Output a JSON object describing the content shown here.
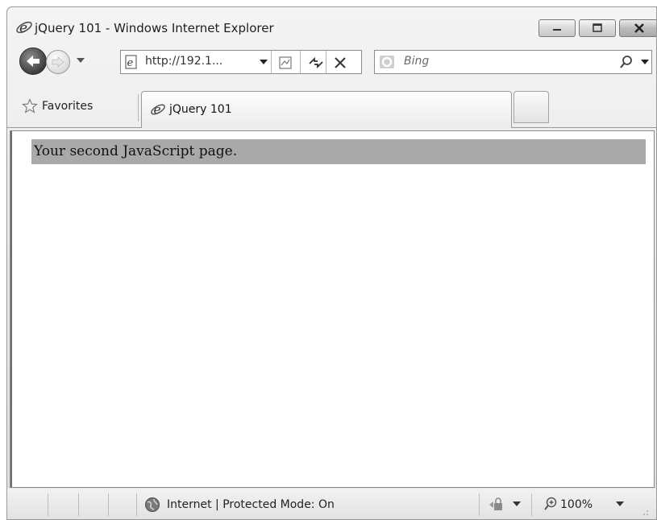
{
  "window": {
    "title": "jQuery 101 - Windows Internet Explorer"
  },
  "nav": {
    "address": "http://192.1...",
    "search_placeholder": "Bing"
  },
  "tabs": {
    "favorites_label": "Favorites",
    "active_tab_label": "jQuery 101"
  },
  "content": {
    "heading": "Your second JavaScript page.",
    "heading_background": "#a9a9a9"
  },
  "status": {
    "zone": "Internet | Protected Mode: On",
    "zoom": "100%"
  },
  "icons": {
    "title": "ie-logo-icon",
    "back": "back-arrow-icon",
    "forward": "forward-arrow-icon",
    "compat": "compatibility-view-icon",
    "refresh": "refresh-icon",
    "stop": "stop-icon",
    "search": "magnifier-icon",
    "favorites": "star-icon",
    "zone": "globe-icon",
    "security": "lock-icon",
    "zoom": "zoom-icon"
  }
}
